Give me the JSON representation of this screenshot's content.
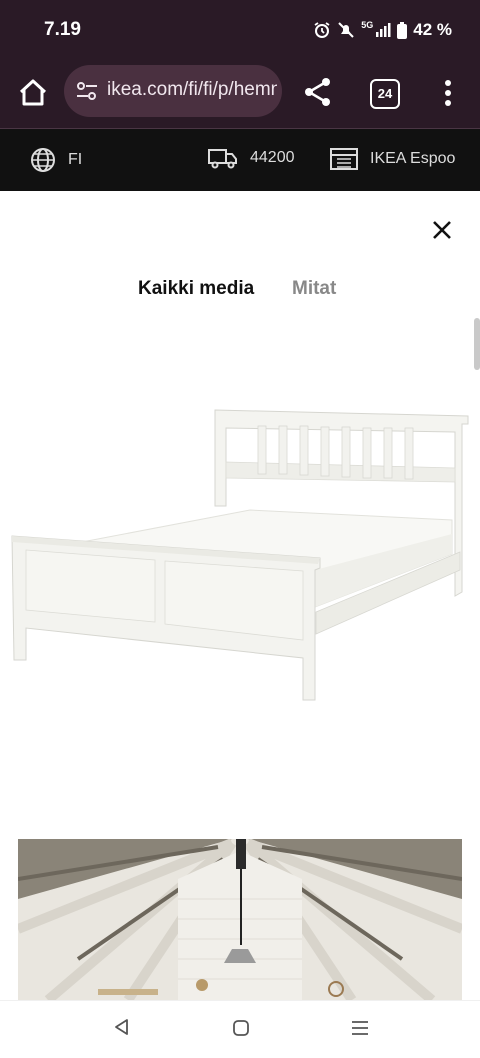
{
  "status": {
    "time": "7.19",
    "network": "5G",
    "battery": "42 %"
  },
  "browser": {
    "url": "ikea.com/fi/fi/p/hemnes",
    "tab_count": "24",
    "icons": [
      "home-icon",
      "site-settings-icon",
      "share-icon",
      "tabs-icon",
      "more-menu-icon"
    ]
  },
  "ikea_bar": {
    "language": "FI",
    "postal_code": "44200",
    "store": "IKEA Espoo"
  },
  "modal": {
    "tabs": [
      {
        "label": "Kaikki media",
        "active": true
      },
      {
        "label": "Mitat",
        "active": false
      }
    ]
  },
  "colors": {
    "browser_bar": "#2a1a26",
    "ikea_bar": "#111111",
    "active_tab": "#111111",
    "inactive_tab": "#888888"
  }
}
